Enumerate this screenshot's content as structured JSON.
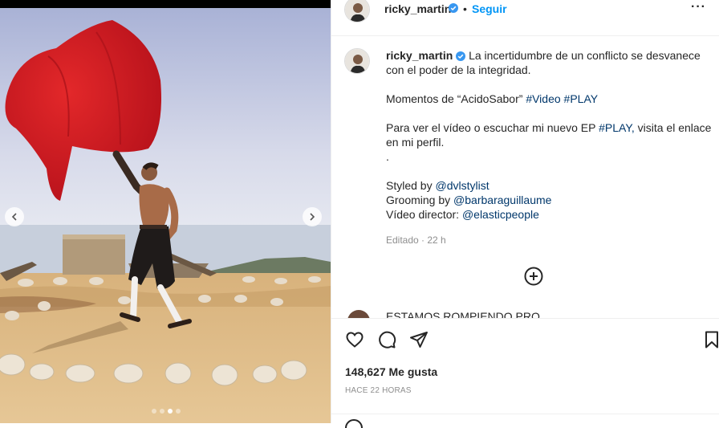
{
  "post": {
    "username": "ricky_martin",
    "follow_label": "Seguir",
    "bullet": "•",
    "more_label": "···",
    "caption": {
      "line1": "La incertidumbre de un conflicto se desvanece con el poder de la integridad.",
      "line2_prefix": "Momentos de “AcidoSabor”",
      "line2_tag1": "#Video",
      "line2_tag2": "#PLAY",
      "line3_prefix": "Para ver el vídeo o escuchar mi nuevo EP",
      "line3_tag": "#PLAY,",
      "line3_suffix": "visita el enlace en mi perfil.",
      "dot": ".",
      "styled_prefix": "Styled by",
      "styled_tag": "@dvlstylist",
      "grooming_prefix": "Grooming by",
      "grooming_tag": "@barbaraguillaume",
      "director_prefix": "Vídeo director:",
      "director_tag": "@elasticpeople"
    },
    "time_edited": "Editado · 22 h",
    "comment_peek": "ESTAMOS ROMPIENDO PRO",
    "likes": "148,627 Me gusta",
    "ago": "HACE 22 HORAS"
  },
  "carousel": {
    "slide_count": 4,
    "active_index": 2
  },
  "icons": {
    "verified": "verified-badge-icon",
    "add": "add-comment-icon",
    "like": "heart-icon",
    "comment": "comment-icon",
    "share": "paper-plane-icon",
    "save": "bookmark-icon",
    "prev": "chevron-left-icon",
    "next": "chevron-right-icon"
  },
  "colors": {
    "link": "#00376b",
    "follow": "#0095f6",
    "verified": "#3897f0",
    "muted": "#8e8e8e"
  }
}
